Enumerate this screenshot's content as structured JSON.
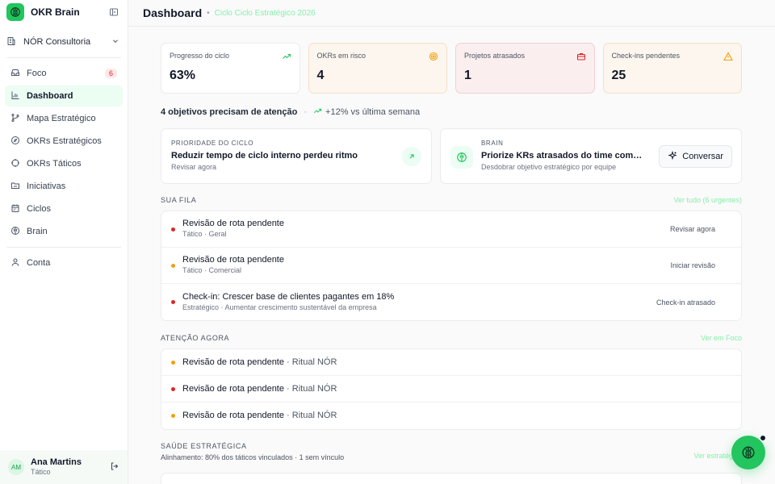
{
  "app": {
    "title": "OKR Brain"
  },
  "org": {
    "name": "NÓR Consultoria"
  },
  "colors": {
    "accent": "#22c55e",
    "danger": "#dc2626",
    "warning": "#f59e0b"
  },
  "sidebar": {
    "items": [
      {
        "label": "Foco",
        "icon": "inbox-icon",
        "badge": "6"
      },
      {
        "label": "Dashboard",
        "icon": "bar-chart-icon",
        "active": true
      },
      {
        "label": "Mapa Estratégico",
        "icon": "branch-icon"
      },
      {
        "label": "OKRs Estratégicos",
        "icon": "compass-icon"
      },
      {
        "label": "OKRs Táticos",
        "icon": "crosshair-icon"
      },
      {
        "label": "Iniciativas",
        "icon": "folder-icon"
      },
      {
        "label": "Ciclos",
        "icon": "calendar-icon"
      },
      {
        "label": "Brain",
        "icon": "brain-icon"
      },
      {
        "label": "Conta",
        "icon": "user-icon"
      }
    ]
  },
  "user": {
    "initials": "AM",
    "name": "Ana Martins",
    "role": "Tático"
  },
  "header": {
    "title": "Dashboard",
    "cycle": "Ciclo Ciclo Estratégico 2026"
  },
  "kpis": [
    {
      "label": "Progresso do ciclo",
      "value": "63%",
      "icon": "trend-up-icon"
    },
    {
      "label": "OKRs em risco",
      "value": "4",
      "icon": "target-icon"
    },
    {
      "label": "Projetos atrasados",
      "value": "1",
      "icon": "briefcase-icon"
    },
    {
      "label": "Check-ins pendentes",
      "value": "25",
      "icon": "alert-triangle-icon"
    }
  ],
  "attention": {
    "summary": "4 objetivos precisam de atenção",
    "trend": "+12% vs última semana"
  },
  "priority_card": {
    "kicker": "PRIORIDADE DO CICLO",
    "title": "Reduzir tempo de ciclo interno perdeu ritmo",
    "subtitle": "Revisar agora"
  },
  "brain_card": {
    "kicker": "BRAIN",
    "title": "Priorize KRs atrasados do time com…",
    "subtitle": "Desdobrar objetivo estratégico por equipe",
    "button": "Conversar"
  },
  "queue": {
    "title": "SUA FILA",
    "link": "Ver tudo (6 urgentes)",
    "rows": [
      {
        "title": "Revisão de rota pendente",
        "subtitle": "Tático · Geral",
        "action": "Revisar agora",
        "status": "danger"
      },
      {
        "title": "Revisão de rota pendente",
        "subtitle": "Tático · Comercial",
        "action": "Iniciar revisão",
        "status": "warning"
      },
      {
        "title": "Check-in: Crescer base de clientes pagantes em 18%",
        "subtitle": "Estratégico · Aumentar crescimento sustentável da empresa",
        "action": "Check-in atrasado",
        "status": "danger"
      }
    ]
  },
  "attention_now": {
    "title": "ATENÇÃO AGORA",
    "link": "Ver em Foco",
    "rows": [
      {
        "title": "Revisão de rota pendente",
        "context": " · Ritual NÓR",
        "status": "warning"
      },
      {
        "title": "Revisão de rota pendente",
        "context": " · Ritual NÓR",
        "status": "danger"
      },
      {
        "title": "Revisão de rota pendente",
        "context": " · Ritual NÓR",
        "status": "warning"
      }
    ]
  },
  "health": {
    "title": "SAÚDE ESTRATÉGICA",
    "subtitle": "Alinhamento: 80% dos táticos vinculados · 1 sem vínculo",
    "link": "Ver estratégi…"
  }
}
